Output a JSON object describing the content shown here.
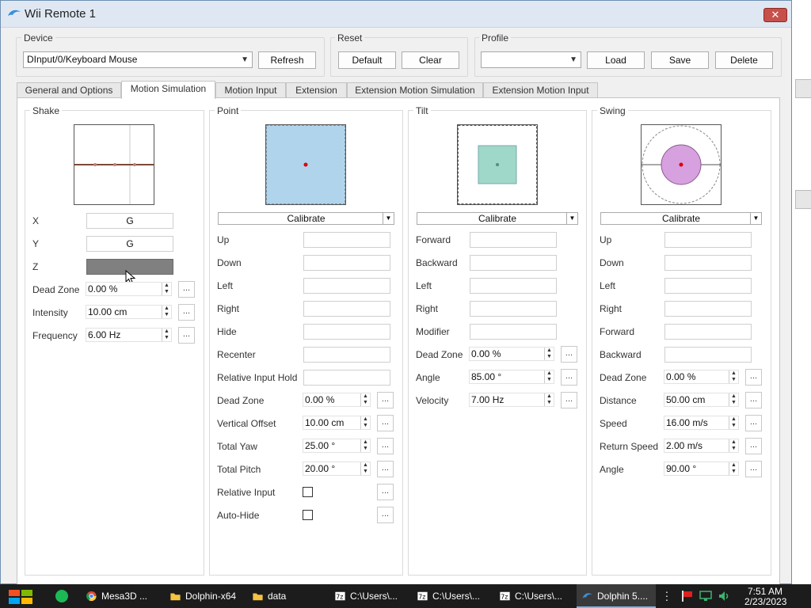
{
  "window": {
    "title": "Wii Remote 1"
  },
  "device": {
    "group_label": "Device",
    "selected": "DInput/0/Keyboard Mouse",
    "refresh_label": "Refresh"
  },
  "reset": {
    "group_label": "Reset",
    "default_label": "Default",
    "clear_label": "Clear"
  },
  "profile": {
    "group_label": "Profile",
    "selected": "",
    "load_label": "Load",
    "save_label": "Save",
    "delete_label": "Delete"
  },
  "tabs": [
    {
      "label": "General and Options"
    },
    {
      "label": "Motion Simulation",
      "active": true
    },
    {
      "label": "Motion Input"
    },
    {
      "label": "Extension"
    },
    {
      "label": "Extension Motion Simulation"
    },
    {
      "label": "Extension Motion Input"
    }
  ],
  "shake": {
    "label": "Shake",
    "x_label": "X",
    "x_value": "G",
    "y_label": "Y",
    "y_value": "G",
    "z_label": "Z",
    "z_value": "",
    "dead_zone_label": "Dead Zone",
    "dead_zone_value": "0.00 %",
    "intensity_label": "Intensity",
    "intensity_value": "10.00 cm",
    "frequency_label": "Frequency",
    "frequency_value": "6.00 Hz"
  },
  "point": {
    "label": "Point",
    "calibrate_label": "Calibrate",
    "rows": [
      "Up",
      "Down",
      "Left",
      "Right",
      "Hide",
      "Recenter",
      "Relative Input Hold"
    ],
    "dead_zone_label": "Dead Zone",
    "dead_zone_value": "0.00 %",
    "vertical_offset_label": "Vertical Offset",
    "vertical_offset_value": "10.00 cm",
    "total_yaw_label": "Total Yaw",
    "total_yaw_value": "25.00 °",
    "total_pitch_label": "Total Pitch",
    "total_pitch_value": "20.00 °",
    "relative_input_label": "Relative Input",
    "auto_hide_label": "Auto-Hide"
  },
  "tilt": {
    "label": "Tilt",
    "calibrate_label": "Calibrate",
    "rows": [
      "Forward",
      "Backward",
      "Left",
      "Right",
      "Modifier"
    ],
    "dead_zone_label": "Dead Zone",
    "dead_zone_value": "0.00 %",
    "angle_label": "Angle",
    "angle_value": "85.00 °",
    "velocity_label": "Velocity",
    "velocity_value": "7.00 Hz"
  },
  "swing": {
    "label": "Swing",
    "calibrate_label": "Calibrate",
    "rows": [
      "Up",
      "Down",
      "Left",
      "Right",
      "Forward",
      "Backward"
    ],
    "dead_zone_label": "Dead Zone",
    "dead_zone_value": "0.00 %",
    "distance_label": "Distance",
    "distance_value": "50.00 cm",
    "speed_label": "Speed",
    "speed_value": "16.00 m/s",
    "return_speed_label": "Return Speed",
    "return_speed_value": "2.00 m/s",
    "angle_label": "Angle",
    "angle_value": "90.00 °"
  },
  "more_button_label": "...",
  "taskbar": {
    "items": [
      {
        "label": "Mesa3D ...",
        "icon": "chrome-icon"
      },
      {
        "label": "Dolphin-x64",
        "icon": "folder-icon"
      },
      {
        "label": "data",
        "icon": "folder-icon"
      },
      {
        "label": "C:\\Users\\...",
        "icon": "7zip-icon"
      },
      {
        "label": "C:\\Users\\...",
        "icon": "7zip-icon"
      },
      {
        "label": "C:\\Users\\...",
        "icon": "7zip-icon"
      },
      {
        "label": "Dolphin 5....",
        "icon": "dolphin-icon",
        "active": true
      }
    ],
    "clock_time": "7:51 AM",
    "clock_date": "2/23/2023"
  },
  "colors": {
    "point_fill": "#b0d4ec",
    "tilt_fill": "#9fd8c8",
    "swing_fill": "#d7a0de",
    "indicator": "#e00000"
  }
}
